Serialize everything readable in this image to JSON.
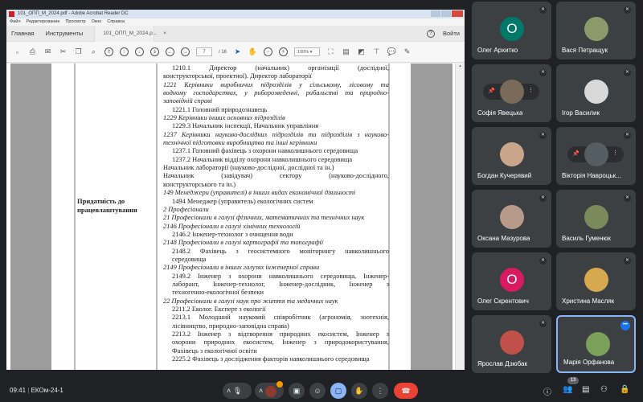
{
  "acrobat": {
    "title": "101_ОПП_М_2024.pdf - Adobe Acrobat Reader DC",
    "menu": [
      "Файл",
      "Редактирование",
      "Просмотр",
      "Окно",
      "Справка"
    ],
    "tabs": {
      "home": "Главная",
      "tools": "Инструменты",
      "document": "101_ОПП_М_2024.p...",
      "close": "×"
    },
    "sign_in": "Войти",
    "page_current": "7",
    "page_total": "/ 16",
    "zoom": "100%"
  },
  "document": {
    "row_label": "Придатність до працевлаштування",
    "lines": [
      {
        "text": "1210.1 Директор (начальник) організації (дослідної,",
        "italic": false,
        "indent": true,
        "justify": true
      },
      {
        "text": "конструкторської, проектної). Директор лабораторії",
        "italic": false,
        "indent": false,
        "justify": false
      },
      {
        "text": "1221 Керівники виробничих підрозділів у сільському, лісовому та",
        "italic": true,
        "indent": false,
        "justify": true
      },
      {
        "text": "водному господарствах, у риборозведенні, рибальстві та природно-",
        "italic": true,
        "indent": false,
        "justify": true
      },
      {
        "text": "заповідній справі",
        "italic": true,
        "indent": false,
        "justify": false
      },
      {
        "text": "1221.1 Головний природознавець",
        "italic": false,
        "indent": true,
        "justify": false
      },
      {
        "text": "1229 Керівники інших основних підрозділів",
        "italic": true,
        "indent": false,
        "justify": false
      },
      {
        "text": "1229.3 Начальник інспекції, Начальник управління",
        "italic": false,
        "indent": true,
        "justify": false
      },
      {
        "text": "1237 Керівники науково-дослідних підрозділів та підрозділів з науково-",
        "italic": true,
        "indent": false,
        "justify": true
      },
      {
        "text": "технічної підготовки виробництва та інші керівники",
        "italic": true,
        "indent": false,
        "justify": false
      },
      {
        "text": "1237.1 Головний фахівець з охорони навколишнього середовища",
        "italic": false,
        "indent": true,
        "justify": false
      },
      {
        "text": "1237.2 Начальник відділу охорони навколишнього середовища",
        "italic": false,
        "indent": true,
        "justify": false
      },
      {
        "text": "Начальник лабораторії (науково-дослідної, дослідної та ін.)",
        "italic": false,
        "indent": false,
        "justify": false
      },
      {
        "text": "Начальник (завідувач) сектору (науково-дослідного,",
        "italic": false,
        "indent": false,
        "justify": true
      },
      {
        "text": "конструкторського та ін.)",
        "italic": false,
        "indent": false,
        "justify": false
      },
      {
        "text": "149 Менеджери (управителі) в інших видах економічної діяльності",
        "italic": true,
        "indent": false,
        "justify": false
      },
      {
        "text": "1494 Менеджер (управитель) екологічних систем",
        "italic": false,
        "indent": true,
        "justify": false
      },
      {
        "text": "2 Професіонали",
        "italic": true,
        "indent": false,
        "justify": false
      },
      {
        "text": "21 Професіонали в галузі фізичних, математичних та технічних наук",
        "italic": true,
        "indent": false,
        "justify": false
      },
      {
        "text": "2146 Професіонали в галузі хімічних технологій",
        "italic": true,
        "indent": false,
        "justify": false
      },
      {
        "text": "2146.2 Інженер-технолог з очищення води",
        "italic": false,
        "indent": true,
        "justify": false
      },
      {
        "text": "2148 Професіонали в галузі картографії та топографії",
        "italic": true,
        "indent": false,
        "justify": false
      },
      {
        "text": "2148.2 Фахівець з геосистемного моніторингу навколишнього",
        "italic": false,
        "indent": true,
        "justify": true
      },
      {
        "text": "середовища",
        "italic": false,
        "indent": true,
        "justify": false
      },
      {
        "text": "2149 Професіонали в інших галузях інженерної справи",
        "italic": true,
        "indent": false,
        "justify": false
      },
      {
        "text": "2149.2 Інженер з охорони навколишнього середовища, Інженер-",
        "italic": false,
        "indent": true,
        "justify": true
      },
      {
        "text": "лаборант, Інженер-технолог, Інженер-дослідник, Інженер з",
        "italic": false,
        "indent": true,
        "justify": true
      },
      {
        "text": "техногенно-екологічної безпеки",
        "italic": false,
        "indent": true,
        "justify": false
      },
      {
        "text": "22 Професіонали в галузі наук про життя та медичних наук",
        "italic": true,
        "indent": false,
        "justify": false
      },
      {
        "text": "2211.2 Еколог. Експерт з екології",
        "italic": false,
        "indent": true,
        "justify": false
      },
      {
        "text": "2213.1 Молодший науковий співробітник (агрономія, зоотехнія,",
        "italic": false,
        "indent": true,
        "justify": true
      },
      {
        "text": "лісівництво, природно-заповідна справа)",
        "italic": false,
        "indent": true,
        "justify": false
      },
      {
        "text": "2213.2 Інженер з відтворення природних екосистем, Інженер з",
        "italic": false,
        "indent": true,
        "justify": true
      },
      {
        "text": "охорони природних екосистем, Інженер з природокористування,",
        "italic": false,
        "indent": true,
        "justify": true
      },
      {
        "text": "Фахівець з екологічної освіти",
        "italic": false,
        "indent": true,
        "justify": false
      },
      {
        "text": "2225.2 Фахівець з дослідження факторів навколишнього середовища",
        "italic": false,
        "indent": true,
        "justify": false
      }
    ]
  },
  "participants": [
    {
      "name": "Олег Архитко",
      "initial": "О",
      "color": "#00796b",
      "pinned": false
    },
    {
      "name": "Вася Петращук",
      "initial": "",
      "color": "#8a9a6a",
      "pinned": false
    },
    {
      "name": "Софія Явецька",
      "initial": "",
      "color": "#7a6a5a",
      "pinned": true
    },
    {
      "name": "Ігор Василик",
      "initial": "",
      "color": "#d8d8d8",
      "pinned": false
    },
    {
      "name": "Богдан Кучерявий",
      "initial": "",
      "color": "#c9a58a",
      "pinned": false
    },
    {
      "name": "Вікторія Навроцьк...",
      "initial": "",
      "color": "#555c62",
      "pinned": true
    },
    {
      "name": "Оксана Мазурова",
      "initial": "",
      "color": "#b89a8a",
      "pinned": false
    },
    {
      "name": "Василь Гуменюк",
      "initial": "",
      "color": "#7a8a5a",
      "pinned": false
    },
    {
      "name": "Олег Скрентович",
      "initial": "О",
      "color": "#d81b60",
      "pinned": false
    },
    {
      "name": "Христина Масляк",
      "initial": "",
      "color": "#d6a850",
      "pinned": false
    },
    {
      "name": "Ярослав Дзюбак",
      "initial": "",
      "color": "#c0504a",
      "pinned": false
    },
    {
      "name": "Марія Орфанова",
      "initial": "",
      "color": "#7aa05a",
      "pinned": false,
      "selected": true
    }
  ],
  "meet": {
    "time": "09:41",
    "separator": "|",
    "meeting_code": "ЕКОм-24-1",
    "participant_count": "13",
    "colors": {
      "end_call": "#ea4335",
      "present_active": "#8ab4f8",
      "accent": "#1a73e8"
    }
  }
}
